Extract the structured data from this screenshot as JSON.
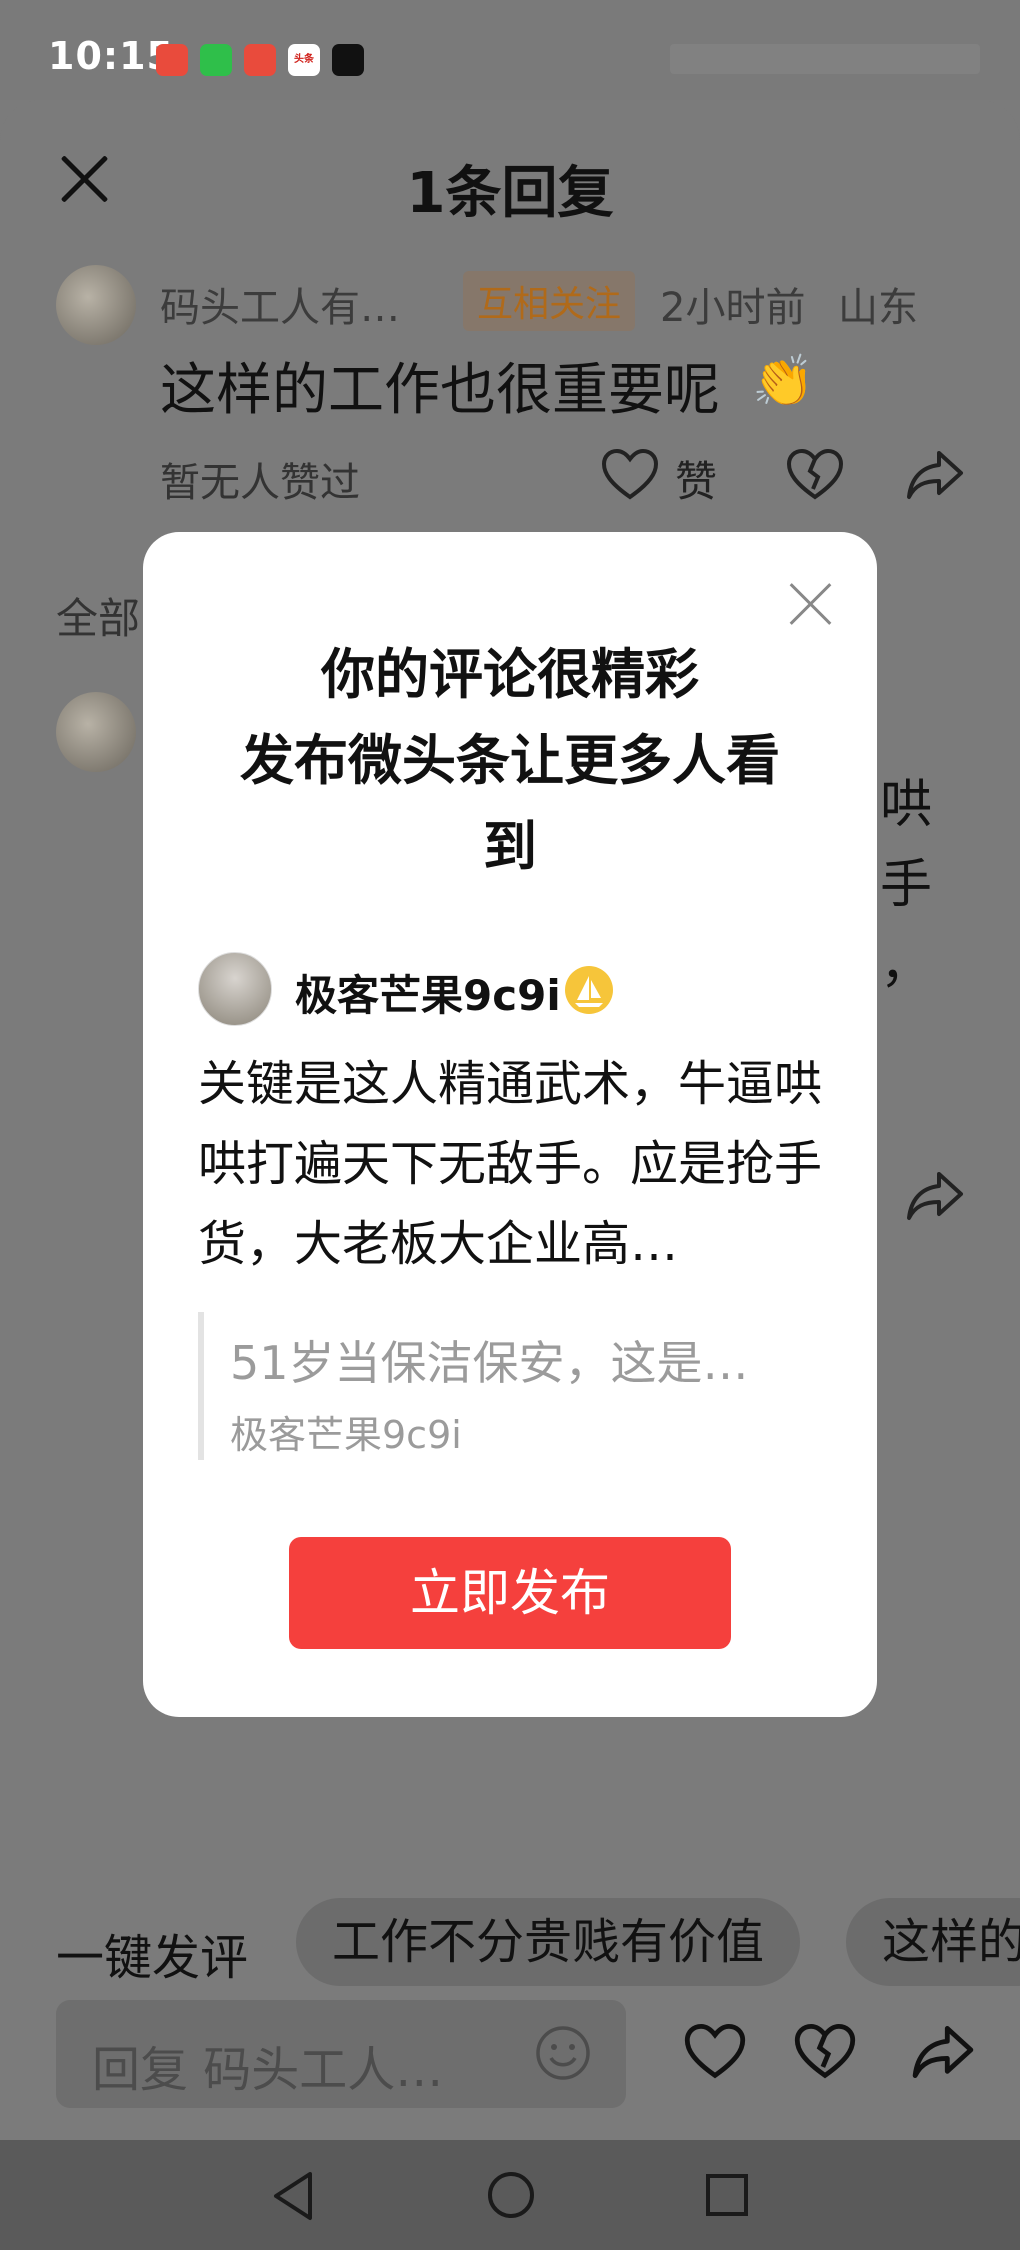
{
  "status_bar": {
    "time": "10:15",
    "apps": [
      "taobao-icon",
      "wechat-icon",
      "taobao-icon",
      "toutiao-icon",
      "capcut-icon"
    ],
    "app_labels": [
      "",
      "",
      "",
      "头条",
      ""
    ]
  },
  "header": {
    "title": "1条回复"
  },
  "comment": {
    "username": "码头工人有…",
    "badge": "互相关注",
    "time": "2小时前",
    "location": "山东",
    "text": "这样的工作也很重要呢",
    "emoji": "👏",
    "likes_text": "暂无人赞过",
    "like_label": "赞"
  },
  "section": {
    "all_label": "全部"
  },
  "reply_peek": {
    "line1": "哄",
    "line2": "手",
    "line3": "，"
  },
  "modal": {
    "title_lines": [
      "你的评论很精彩",
      "发布微头条让更多人看",
      "到"
    ],
    "username": "极客芒果9c9i",
    "comment_text": "关键是这人精通武术，牛逼哄哄打遍天下无敌手。应是抢手货，大老板大企业高…",
    "quote_title": "51岁当保洁保安，这是…",
    "quote_author": "极客芒果9c9i",
    "publish_label": "立即发布"
  },
  "suggestions": {
    "label": "一键发评",
    "chips": [
      "工作不分贵贱有价值",
      "这样的"
    ]
  },
  "input": {
    "placeholder": "回复 码头工人…"
  },
  "colors": {
    "accent": "#f5403d",
    "overlay": "#7b7b7b",
    "badge_text": "#b06a1a"
  }
}
